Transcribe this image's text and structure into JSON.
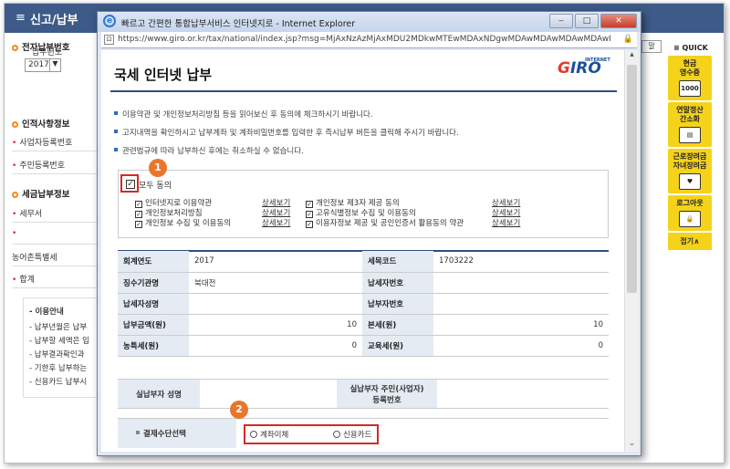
{
  "background": {
    "header_title": "신고/납부",
    "sections": {
      "electronic": "전자납부번호",
      "person": "인적사항정보",
      "tax": "세금납부정보"
    },
    "year_label": "납부년도",
    "year_value": "2017",
    "rows_person": [
      "사업자등록번호",
      "주민등록번호"
    ],
    "rows_tax": [
      "세무서",
      "",
      "농어촌특별세",
      "합계"
    ],
    "info_title": "이용안내",
    "info_items": [
      "납부년월은 납부",
      "납부할 세액은 입",
      "납부결과확인과",
      "기한후 납부하는",
      "신용카드 납부시"
    ],
    "right_fragment": "말"
  },
  "quick": {
    "title": "QUICK",
    "items": [
      {
        "label": "현금\n영수증",
        "icon": "1000"
      },
      {
        "label": "연말정산\n간소화",
        "icon": "doc"
      },
      {
        "label": "근로장려금\n자녀장려금",
        "icon": "heart"
      },
      {
        "label": "로그아웃",
        "icon": "lock"
      }
    ],
    "close": "접기∧"
  },
  "window": {
    "title": "빠르고 간편한 통합납부서비스 인터넷지로 - Internet Explorer",
    "url": "https://www.giro.or.kr/tax/national/index.jsp?msg=MjAxNzAzMjAxMDU2MDkwMTEwMDAxNDgwMDAwMDAwMDAwMDAwMDAwMDAwMDAwMDAwMGdh"
  },
  "page": {
    "title": "국세 인터넷 납부",
    "logo": "GIRO",
    "logo_sub": "INTERNET",
    "notices": [
      "이용약관 및 개인정보처리방침 등을 읽어보신 후 동의에 체크하시기 바랍니다.",
      "고지내역을 확인하시고 납부계좌 및 계좌비밀번호를 입력한 후 즉시납부 버튼을 클릭해 주시기 바랍니다.",
      "관련법규에 따라 납부하신 후에는 취소하실 수 없습니다."
    ],
    "agree_all": "모두 동의",
    "agree_left": [
      "인터넷지로 이용약관",
      "개인정보처리방침",
      "개인정보 수집 및 이용동의"
    ],
    "agree_right": [
      "개인정보 제3자 제공 동의",
      "고유식별정보 수집 및 이용동의",
      "이용자정보 제공 및 공인인증서 활용동의 약관"
    ],
    "detail_link": "상세보기",
    "badge1": "1",
    "badge2": "2",
    "table": [
      {
        "h1": "회계연도",
        "v1": "2017",
        "h2": "세목코드",
        "v2": "1703222"
      },
      {
        "h1": "징수기관명",
        "v1": "북대전",
        "h2": "납세자번호",
        "v2": ""
      },
      {
        "h1": "납세자성명",
        "v1": "",
        "h2": "납부자번호",
        "v2": ""
      },
      {
        "h1": "납부금액(원)",
        "v1": "10",
        "h2": "본세(원)",
        "v2": "10"
      },
      {
        "h1": "농특세(원)",
        "v1": "0",
        "h2": "교육세(원)",
        "v2": "0"
      }
    ],
    "payer_name_label": "실납부자 성명",
    "payer_id_label": "실납부자 주민(사업자)\n등록번호",
    "payment_label": "결제수단선택",
    "payment_options": [
      "계좌이체",
      "신용카드"
    ]
  }
}
